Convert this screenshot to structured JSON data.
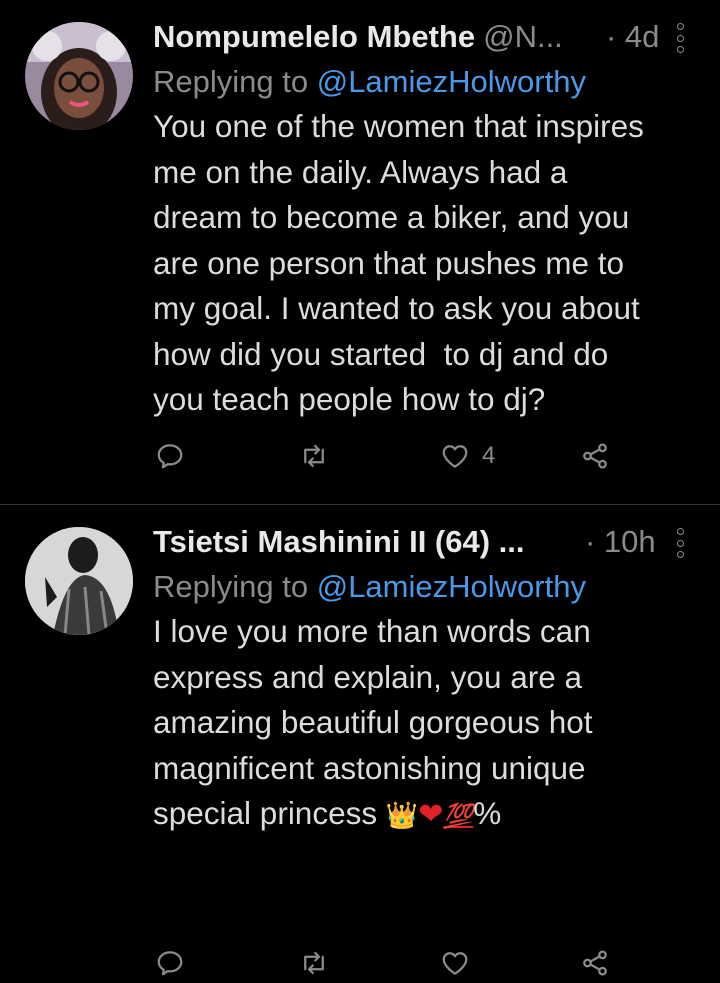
{
  "tweets": [
    {
      "author_name": "Nompumelelo Mbethe",
      "author_handle": "@N...",
      "time": "· 4d",
      "replying_prefix": "Replying to ",
      "replying_to": "@LamiezHolworthy",
      "lines": [
        "You one of the women that inspires",
        "me on the daily. Always had a",
        "dream to become a biker, and you",
        "are one person that pushes me to",
        "my goal. I wanted to ask you about",
        "how did you started  to dj and do",
        "you teach people how to dj?"
      ],
      "like_count": "4"
    },
    {
      "author_name": "Tsietsi Mashinini II (64) ...",
      "time": "· 10h",
      "replying_prefix": "Replying to ",
      "replying_to": "@LamiezHolworthy",
      "lines": [
        "I love you more than words can",
        "express and explain, you are a",
        "amazing beautiful gorgeous hot",
        "magnificent astonishing unique"
      ],
      "last_line_text": "special princess ",
      "emoji": [
        "👑",
        "❤",
        "💯",
        "%"
      ]
    }
  ],
  "icons": [
    "reply-icon",
    "retweet-icon",
    "like-icon",
    "share-icon",
    "more-icon"
  ],
  "colors": {
    "background": "#000000",
    "mention": "#4a99e9",
    "muted": "#8b8b8b"
  }
}
